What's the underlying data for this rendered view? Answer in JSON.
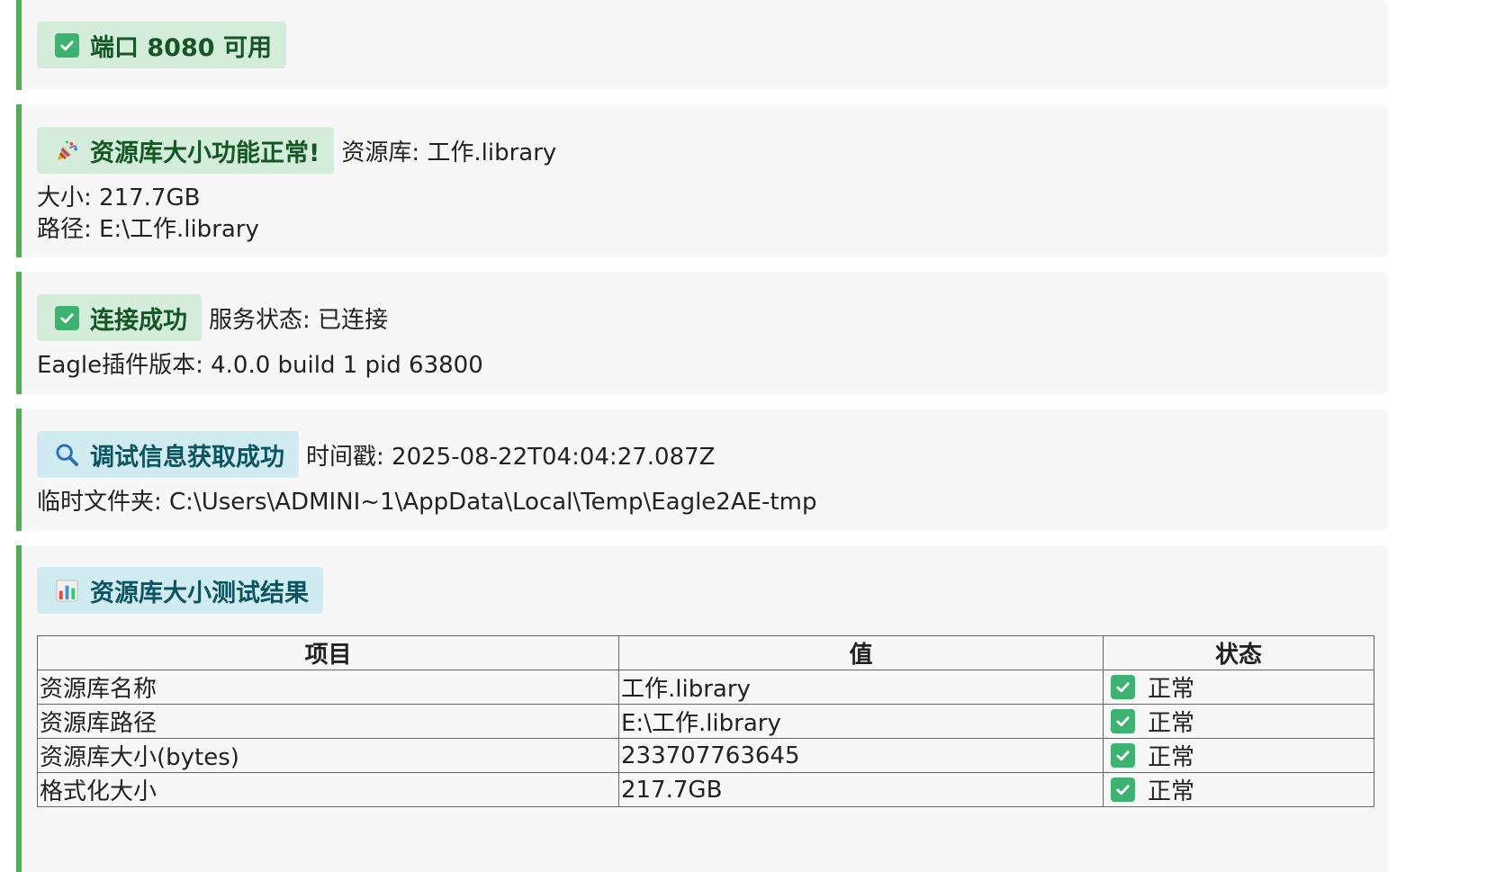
{
  "port_card": {
    "badge": "端口 8080 可用",
    "icon": "check-icon"
  },
  "size_card": {
    "badge": "资源库大小功能正常!",
    "icon": "party-popper-icon",
    "inline": "资源库: 工作.library",
    "lines": [
      "大小: 217.7GB",
      "路径: E:\\工作.library"
    ]
  },
  "connect_card": {
    "badge": "连接成功",
    "icon": "check-icon",
    "inline": "服务状态: 已连接",
    "lines": [
      "Eagle插件版本: 4.0.0 build 1 pid 63800"
    ]
  },
  "debug_card": {
    "badge": "调试信息获取成功",
    "icon": "magnifier-icon",
    "inline": "时间戳: 2025-08-22T04:04:27.087Z",
    "lines": [
      "临时文件夹: C:\\Users\\ADMINI~1\\AppData\\Local\\Temp\\Eagle2AE-tmp"
    ]
  },
  "results_card": {
    "badge": "资源库大小测试结果",
    "icon": "bar-chart-icon",
    "table": {
      "headers": [
        "项目",
        "值",
        "状态"
      ],
      "rows": [
        {
          "item": "资源库名称",
          "value": "工作.library",
          "status": "正常"
        },
        {
          "item": "资源库路径",
          "value": "E:\\工作.library",
          "status": "正常"
        },
        {
          "item": "资源库大小(bytes)",
          "value": "233707763645",
          "status": "正常"
        },
        {
          "item": "格式化大小",
          "value": "217.7GB",
          "status": "正常"
        }
      ]
    }
  },
  "colors": {
    "accent_border": "#4caf50",
    "success_bg": "#d4edda",
    "success_text": "#155724",
    "info_bg": "#d1ecf1",
    "info_text": "#0c5460",
    "card_bg": "#f7f7f7"
  }
}
